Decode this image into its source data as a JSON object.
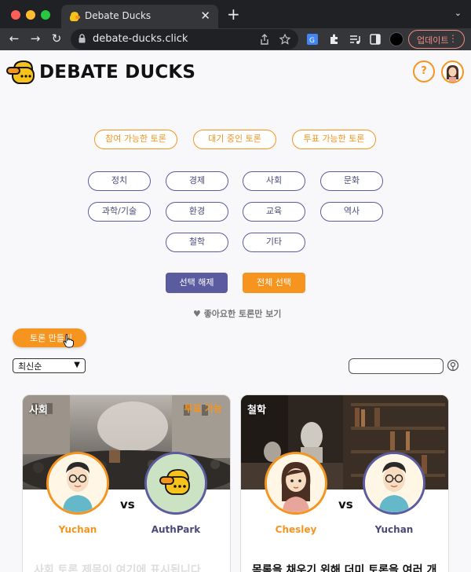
{
  "browser": {
    "tab_title": "Debate Ducks",
    "tab_close": "✕",
    "new_tab": "+",
    "tab_menu": "⌄",
    "url": "debate-ducks.click",
    "update_label": "업데이트",
    "update_menu": "⋮",
    "nav": {
      "back": "←",
      "forward": "→",
      "reload": "↻"
    }
  },
  "header": {
    "logo_text": "DEBATE DUCKS",
    "help_label": "?"
  },
  "status_filters": [
    "참여 가능한 토론",
    "대기 중인 토론",
    "투표 가능한 토론"
  ],
  "categories": [
    "정치",
    "경제",
    "사회",
    "문화",
    "과학/기술",
    "환경",
    "교육",
    "역사",
    "철학",
    "기타"
  ],
  "actions": {
    "clear_label": "선택 해제",
    "select_all_label": "전체 선택",
    "liked_only_label": "♥ 좋아요한 토론만 보기",
    "create_label": "토론 만들기"
  },
  "sort": {
    "selected": "최신순",
    "arrow": "▼"
  },
  "search": {
    "placeholder": ""
  },
  "cards": [
    {
      "category": "사회",
      "status": "투표 가능",
      "left_name": "Yuchan",
      "right_name": "AuthPark",
      "vs": "vs",
      "title": "사회 토론 제목이 여기에 표시됩니다"
    },
    {
      "category": "철학",
      "status": "",
      "left_name": "Chesley",
      "right_name": "Yuchan",
      "vs": "vs",
      "title": "목록을 채우기 위해 더미 토론을 여러 개"
    }
  ],
  "colors": {
    "accent": "#f5941e",
    "secondary": "#5b5ba0",
    "background": "#f8f8fa"
  }
}
